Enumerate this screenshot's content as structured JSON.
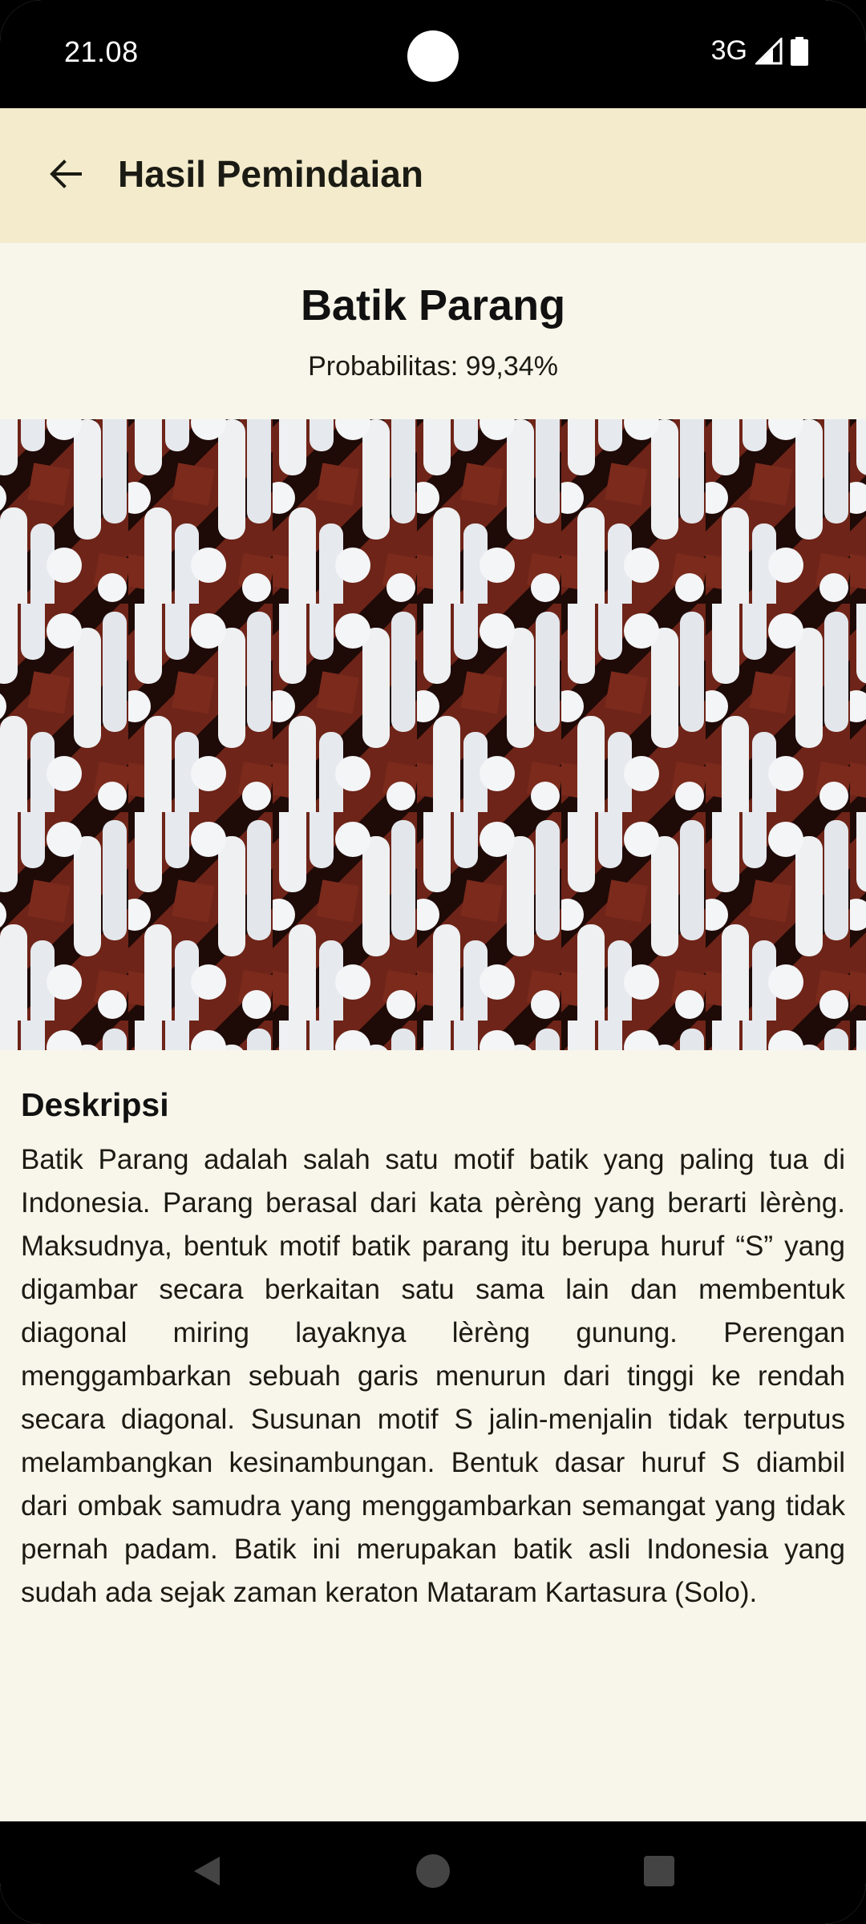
{
  "status_bar": {
    "time": "21.08",
    "network": "3G",
    "icons": [
      "signal-icon",
      "battery-icon"
    ]
  },
  "app_bar": {
    "back_icon": "arrow-left-icon",
    "title": "Hasil Pemindaian"
  },
  "result": {
    "name": "Batik Parang",
    "probability": "Probabilitas: 99,34%"
  },
  "description": {
    "heading": "Deskripsi",
    "text": "Batik Parang adalah salah satu motif batik yang paling tua di Indonesia. Parang berasal dari kata pèrèng yang berarti lèrèng. Maksudnya, bentuk motif batik parang itu berupa huruf “S” yang digambar secara berkaitan satu sama lain dan membentuk diagonal miring layaknya lèrèng gunung. Perengan menggambarkan sebuah garis menurun dari tinggi ke rendah secara diagonal. Susunan motif S jalin-menjalin tidak terputus melambangkan kesinambungan. Bentuk dasar huruf S diambil dari ombak samudra yang menggambarkan semangat yang tidak pernah padam. Batik ini merupakan batik asli Indonesia yang sudah ada sejak zaman keraton Mataram Kartasura (Solo)."
  },
  "nav_bar": {
    "icons": [
      "nav-back-icon",
      "nav-home-icon",
      "nav-recents-icon"
    ]
  },
  "colors": {
    "background": "#f8f6ea",
    "app_bar": "#f3ebcb",
    "batik_brown": "#7b2a1c",
    "batik_dark": "#1e0a07",
    "batik_light": "#eef0f2"
  }
}
